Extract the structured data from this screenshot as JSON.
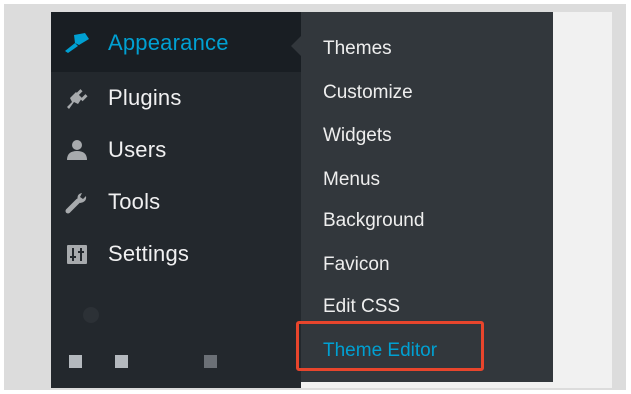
{
  "colors": {
    "sidebar_bg": "#23282d",
    "active_bg": "#191e23",
    "submenu_bg": "#32373c",
    "accent": "#00a0d2",
    "highlight": "#e8452c"
  },
  "sidebar": {
    "items": [
      {
        "label": "Appearance",
        "icon": "paintbrush-icon",
        "active": true
      },
      {
        "label": "Plugins",
        "icon": "plugin-icon"
      },
      {
        "label": "Users",
        "icon": "user-icon"
      },
      {
        "label": "Tools",
        "icon": "wrench-icon"
      },
      {
        "label": "Settings",
        "icon": "settings-icon"
      }
    ]
  },
  "submenu": {
    "items": [
      {
        "label": "Themes"
      },
      {
        "label": "Customize"
      },
      {
        "label": "Widgets"
      },
      {
        "label": "Menus"
      },
      {
        "label": "Background"
      },
      {
        "label": "Favicon"
      },
      {
        "label": "Edit CSS"
      },
      {
        "label": "Theme Editor",
        "current": true,
        "highlighted": true
      }
    ]
  }
}
